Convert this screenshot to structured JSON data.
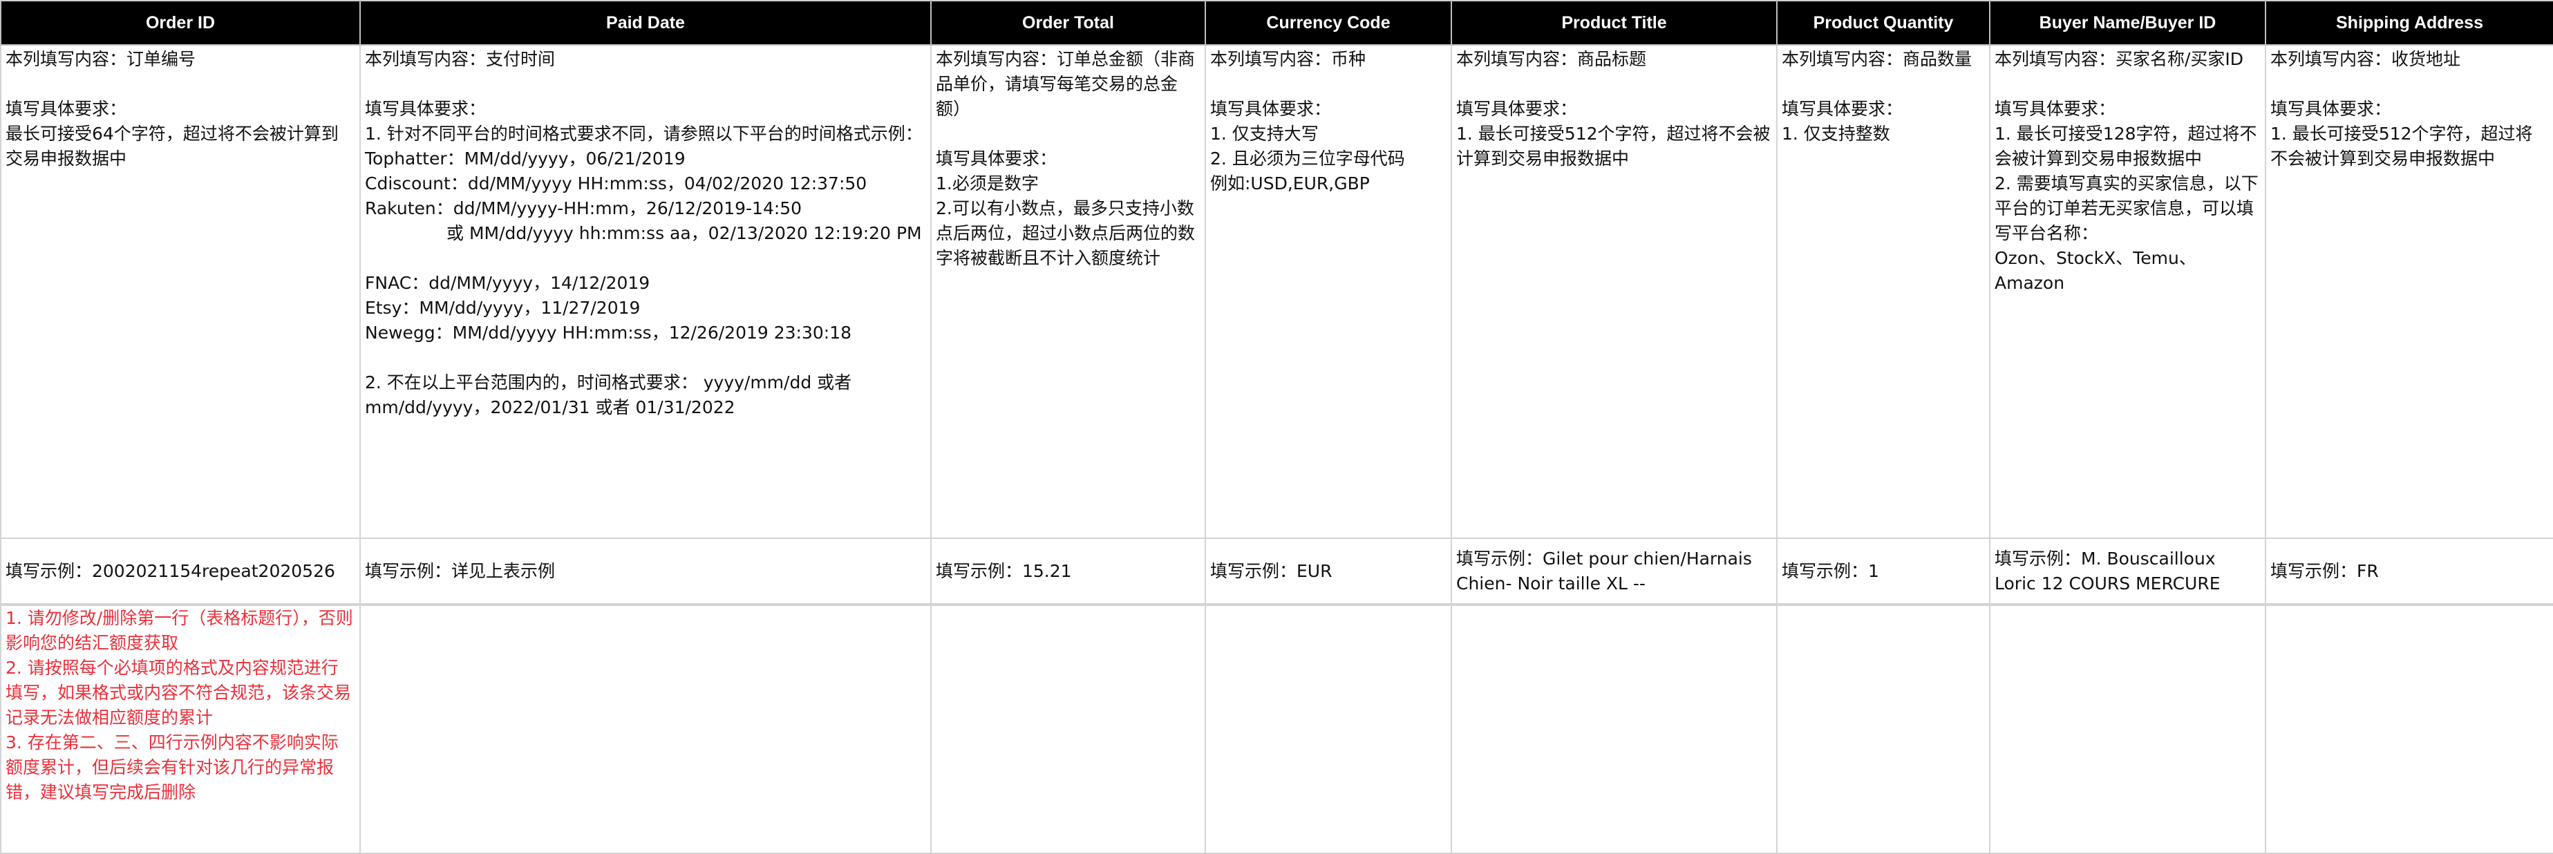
{
  "colors": {
    "header_bg": "#000000",
    "header_text": "#ffffff",
    "body_text": "#111111",
    "note_text": "#e8303a",
    "grid": "#d4d4d4"
  },
  "columns": [
    "Order ID",
    "Paid Date",
    "Order Total",
    "Currency Code",
    "Product Title",
    "Product Quantity",
    "Buyer Name/Buyer ID",
    "Shipping Address"
  ],
  "requirements": {
    "order_id": {
      "content": "本列填写内容：订单编号",
      "req_title": "填写具体要求：",
      "lines": [
        "最长可接受64个字符，超过将不会被计算到交易申报数据中"
      ]
    },
    "paid_date": {
      "content": "本列填写内容：支付时间",
      "req_title": "填写具体要求：",
      "line1": "1. 针对不同平台的时间格式要求不同，请参照以下平台的时间格式示例：",
      "tophatter": "Tophatter：MM/dd/yyyy，06/21/2019",
      "cdiscount": "Cdiscount：dd/MM/yyyy HH:mm:ss，04/02/2020 12:37:50",
      "rakuten": "Rakuten：dd/MM/yyyy-HH:mm，26/12/2019-14:50",
      "rakuten_alt": "或 MM/dd/yyyy hh:mm:ss aa，02/13/2020 12:19:20 PM",
      "fnac": "FNAC：dd/MM/yyyy，14/12/2019",
      "etsy": "Etsy：MM/dd/yyyy，11/27/2019",
      "newegg": "Newegg：MM/dd/yyyy HH:mm:ss，12/26/2019 23:30:18",
      "line2": "2. 不在以上平台范围内的，时间格式要求： yyyy/mm/dd 或者 mm/dd/yyyy，2022/01/31 或者 01/31/2022"
    },
    "order_total": {
      "content": "本列填写内容：订单总金额（非商品单价，请填写每笔交易的总金额）",
      "req_title": "填写具体要求：",
      "lines": [
        "1.必须是数字",
        "2.可以有小数点，最多只支持小数点后两位，超过小数点后两位的数字将被截断且不计入额度统计"
      ]
    },
    "currency_code": {
      "content": "本列填写内容：币种",
      "req_title": "填写具体要求：",
      "lines": [
        "1. 仅支持大写",
        "2. 且必须为三位字母代码",
        "例如:USD,EUR,GBP"
      ]
    },
    "product_title": {
      "content": "本列填写内容：商品标题",
      "req_title": "填写具体要求：",
      "lines": [
        "1. 最长可接受512个字符，超过将不会被计算到交易申报数据中"
      ]
    },
    "product_quantity": {
      "content": "本列填写内容：商品数量",
      "req_title": "填写具体要求：",
      "lines": [
        "1. 仅支持整数"
      ]
    },
    "buyer": {
      "content": "本列填写内容：买家名称/买家ID",
      "req_title": "填写具体要求：",
      "lines": [
        "1. 最长可接受128字符，超过将不会被计算到交易申报数据中",
        "2. 需要填写真实的买家信息，以下平台的订单若无买家信息，可以填写平台名称：",
        "Ozon、StockX、Temu、Amazon"
      ]
    },
    "shipping_address": {
      "content": "本列填写内容：收货地址",
      "req_title": "填写具体要求：",
      "lines": [
        "1. 最长可接受512个字符，超过将不会被计算到交易申报数据中"
      ]
    }
  },
  "examples": [
    "填写示例：2002021154repeat2020526",
    "填写示例：详见上表示例",
    "填写示例：15.21",
    "填写示例：EUR",
    "填写示例：Gilet pour chien/Harnais Chien- Noir taille XL --",
    "填写示例：1",
    "填写示例：M. Bouscailloux Loric 12 COURS MERCURE",
    "填写示例：FR"
  ],
  "notes": [
    "1. 请勿修改/删除第一行（表格标题行），否则影响您的结汇额度获取",
    "2. 请按照每个必填项的格式及内容规范进行填写，如果格式或内容不符合规范，该条交易记录无法做相应额度的累计",
    "3. 存在第二、三、四行示例内容不影响实际额度累计，但后续会有针对该几行的异常报错，建议填写完成后删除"
  ]
}
